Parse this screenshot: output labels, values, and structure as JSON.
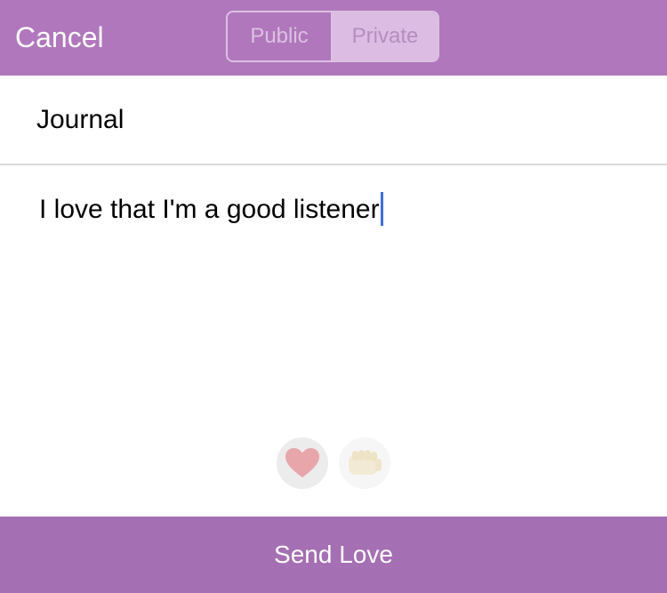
{
  "header": {
    "cancel_label": "Cancel",
    "segments": [
      {
        "label": "Public",
        "selected": false
      },
      {
        "label": "Private",
        "selected": true
      }
    ]
  },
  "entry": {
    "title": "Journal",
    "body": "I love that I'm a good listener"
  },
  "reactions": [
    {
      "icon": "heart-icon",
      "selected": true
    },
    {
      "icon": "fist-bump-icon",
      "selected": false
    }
  ],
  "footer": {
    "send_label": "Send Love"
  },
  "colors": {
    "header_bg": "#b077bd",
    "send_bg": "#a56fb3",
    "caret": "#3b6cf2",
    "heart": "#e8a6ab"
  }
}
